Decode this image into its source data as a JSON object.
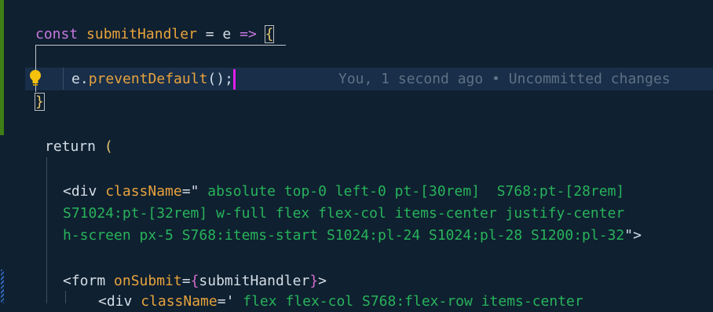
{
  "editor": {
    "line1": {
      "kw": "const",
      "name": "submitHandler",
      "eq": " = e ",
      "arrow": "=>",
      "brace": "{"
    },
    "line2": {
      "obj": "e.",
      "method": "preventDefault",
      "call": "();",
      "blame": "You, 1 second ago • Uncommitted changes"
    },
    "line3": {
      "brace": "}"
    },
    "line4": {
      "kw": "return",
      "paren": "("
    },
    "line5": {
      "open": "<div ",
      "attr": "className",
      "eq": "=\"",
      "value": " absolute top-0 left-0 pt-[30rem]  S768:pt-[28rem]"
    },
    "line6": {
      "value": "S71024:pt-[32rem] w-full flex flex-col items-center justify-center"
    },
    "line7": {
      "value": "h-screen px-5 S768:items-start S1024:pl-24 S1024:pl-28 S1200:pl-32",
      "close": "\">"
    },
    "line8": {
      "open": "<form ",
      "attr": "onSubmit",
      "eq": "=",
      "b1": "{",
      "handler": "submitHandler",
      "b2": "}",
      "close": ">"
    },
    "line9": {
      "open": "<div ",
      "attr": "className",
      "eq": "='",
      "value": " flex flex-col S768:flex-row items-center"
    }
  },
  "colors": {
    "background": "#0f2030",
    "string": "#28b35b",
    "keyword": "#c678dd",
    "function": "#e8a33d",
    "highlight": "#182e49",
    "cursor": "#e01ee8"
  },
  "icons": {
    "gutter": "lightbulb-icon"
  }
}
